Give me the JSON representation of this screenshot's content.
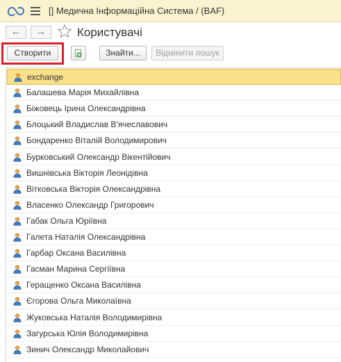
{
  "header": {
    "app_title": "[] Медична Інформаційна Система /  (BAF)",
    "logo_icon": "1c-logo-icon",
    "menu_icon": "hamburger-menu-icon"
  },
  "nav": {
    "back_glyph": "←",
    "forward_glyph": "→",
    "page_title": "Користувачі"
  },
  "toolbar": {
    "create_label": "Створити",
    "find_label": "Знайти...",
    "cancel_search_label": "Відмінити пошук",
    "accent_color": "#d9202a"
  },
  "users": {
    "rows": [
      {
        "name": "exchange",
        "selected": true
      },
      {
        "name": "Балашева Марія Михайлівна"
      },
      {
        "name": "Біжовець Ірина Олександрівна"
      },
      {
        "name": "Блоцький Владислав В'ячеславович"
      },
      {
        "name": "Бондаренко Віталій Володимирович"
      },
      {
        "name": "Бурковський Олександр Вікентійович"
      },
      {
        "name": "Вишнівська Вікторія  Леонідівна"
      },
      {
        "name": "Вітковська Вікторія Олександрівна"
      },
      {
        "name": "Власенко Олександр Григорович"
      },
      {
        "name": "Габак Ольга Юріївна"
      },
      {
        "name": "Галета Наталія Олександрівна"
      },
      {
        "name": "Гарбар Оксана Василівна"
      },
      {
        "name": "Гасман Марина Сергіївна"
      },
      {
        "name": "Геращенко Оксана Василівна"
      },
      {
        "name": "Єгорова Ольга Миколаївна"
      },
      {
        "name": "Жуковська Наталія Володимирівна"
      },
      {
        "name": "Загурська Юлія Володимирівна"
      },
      {
        "name": "Зинич Олександр Миколайович"
      }
    ]
  }
}
